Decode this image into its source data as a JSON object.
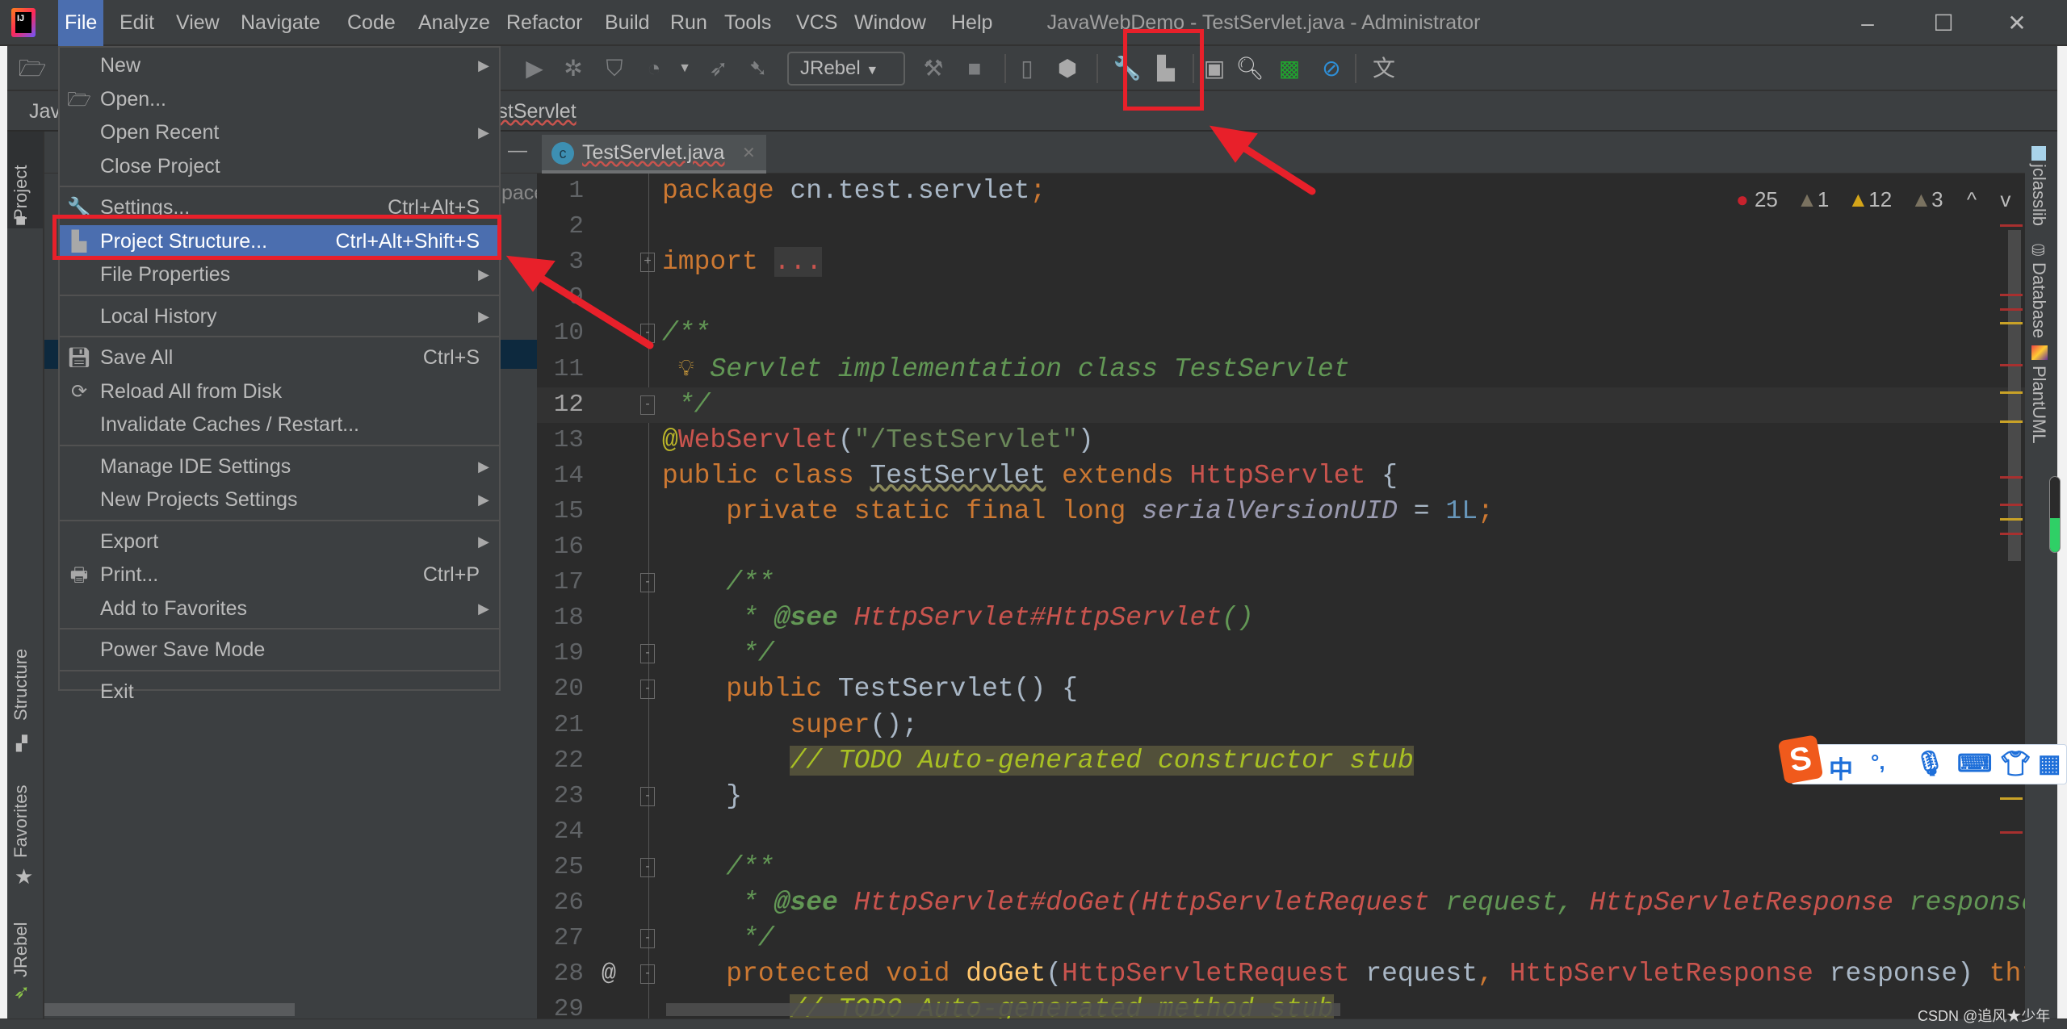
{
  "window": {
    "title": "JavaWebDemo - TestServlet.java - Administrator",
    "minimize": "–",
    "maximize": "☐",
    "close": "✕"
  },
  "menubar": [
    "File",
    "Edit",
    "View",
    "Navigate",
    "Code",
    "Analyze",
    "Refactor",
    "Build",
    "Run",
    "Tools",
    "VCS",
    "Window",
    "Help"
  ],
  "toolbar": {
    "run_config": "JRebel",
    "dropdown_arrow": "▼"
  },
  "navbar": {
    "project": "JavaWebDemo",
    "file": "TestServlet"
  },
  "project_panel": {
    "partial_text": "pace",
    "collapse": "—"
  },
  "left_tools": [
    "Project",
    "Structure",
    "Favorites",
    "JRebel"
  ],
  "right_tools": [
    "jclasslib",
    "Database",
    "PlantUML"
  ],
  "editor": {
    "tab": {
      "label": "TestServlet.java",
      "icon_letter": "c",
      "close": "✕"
    },
    "inspections": {
      "errors": "25",
      "warnings_weak": "1",
      "warnings": "12",
      "typos": "3",
      "prev": "^",
      "next": "v"
    },
    "lines": [
      {
        "n": "1",
        "t": [
          [
            "package ",
            "kw"
          ],
          [
            "cn.test.servlet",
            "tx"
          ],
          [
            ";",
            "kw"
          ]
        ]
      },
      {
        "n": "2",
        "t": []
      },
      {
        "n": "3",
        "t": [
          [
            "import ",
            "kw"
          ],
          [
            "...",
            "dots"
          ]
        ],
        "fold": "+"
      },
      {
        "n": "9",
        "t": []
      },
      {
        "n": "10",
        "t": [
          [
            "/**",
            "doc"
          ]
        ],
        "fold": "-"
      },
      {
        "n": "11",
        "t": [
          [
            " * Servlet implementation class TestServlet",
            "doc"
          ]
        ]
      },
      {
        "n": "12",
        "t": [
          [
            " */",
            "doc"
          ]
        ],
        "fold": "-",
        "current": true
      },
      {
        "n": "13",
        "t": [
          [
            "@",
            "ann"
          ],
          [
            "WebServlet",
            "err"
          ],
          [
            "(",
            "tx"
          ],
          [
            "\"/TestServlet\"",
            "str"
          ],
          [
            ")",
            "tx"
          ]
        ]
      },
      {
        "n": "14",
        "t": [
          [
            "public class ",
            "kw"
          ],
          [
            "TestServlet",
            "tx squig"
          ],
          [
            " extends ",
            "kw"
          ],
          [
            "HttpServlet",
            "err"
          ],
          [
            " {",
            "tx"
          ]
        ]
      },
      {
        "n": "15",
        "t": [
          [
            "    private static final long ",
            "kw"
          ],
          [
            "serialVersionUID",
            "fld"
          ],
          [
            " = ",
            "tx"
          ],
          [
            "1L",
            "num"
          ],
          [
            ";",
            "kw"
          ]
        ]
      },
      {
        "n": "16",
        "t": []
      },
      {
        "n": "17",
        "t": [
          [
            "    /**",
            "doc"
          ]
        ],
        "fold": "-"
      },
      {
        "n": "18",
        "t": [
          [
            "     * ",
            "doc"
          ],
          [
            "@see",
            "doct"
          ],
          [
            " HttpServlet#HttpServlet",
            "erri"
          ],
          [
            "()",
            "doc"
          ]
        ]
      },
      {
        "n": "19",
        "t": [
          [
            "     */",
            "doc"
          ]
        ],
        "fold": "-"
      },
      {
        "n": "20",
        "t": [
          [
            "    public ",
            "kw"
          ],
          [
            "TestServlet() {",
            "tx"
          ]
        ],
        "fold": "-"
      },
      {
        "n": "21",
        "t": [
          [
            "        super",
            "kw"
          ],
          [
            "();",
            "tx"
          ]
        ]
      },
      {
        "n": "22",
        "t": [
          [
            "        ",
            "tx"
          ],
          [
            "// TODO Auto-generated constructor stub",
            "todo"
          ]
        ]
      },
      {
        "n": "23",
        "t": [
          [
            "    }",
            "tx"
          ]
        ],
        "fold": "-"
      },
      {
        "n": "24",
        "t": []
      },
      {
        "n": "25",
        "t": [
          [
            "    /**",
            "doc"
          ]
        ],
        "fold": "-"
      },
      {
        "n": "26",
        "t": [
          [
            "     * ",
            "doc"
          ],
          [
            "@see",
            "doct"
          ],
          [
            " HttpServlet#doGet(HttpServletRequest",
            "erri"
          ],
          [
            " request, ",
            "doc"
          ],
          [
            "HttpServletResponse",
            "erri"
          ],
          [
            " response)",
            "doc"
          ]
        ]
      },
      {
        "n": "27",
        "t": [
          [
            "     */",
            "doc"
          ]
        ],
        "fold": "-"
      },
      {
        "n": "28",
        "t": [
          [
            "    protected void ",
            "kw"
          ],
          [
            "doGet",
            "fn"
          ],
          [
            "(",
            "tx"
          ],
          [
            "HttpServletRequest",
            "err"
          ],
          [
            " request",
            "tx"
          ],
          [
            ", ",
            "kw"
          ],
          [
            "HttpServletResponse",
            "err"
          ],
          [
            " response) ",
            "tx"
          ],
          [
            "throws ServletException, IOException {",
            "kw"
          ]
        ],
        "fold": "-",
        "gutter": "@"
      },
      {
        "n": "29",
        "t": [
          [
            "        ",
            "tx"
          ],
          [
            "// TODO Auto-generated method stub",
            "todo"
          ]
        ]
      }
    ]
  },
  "file_menu": [
    {
      "label": "New",
      "arrow": true
    },
    {
      "label": "Open...",
      "icon": "folder-open-icon"
    },
    {
      "label": "Open Recent",
      "arrow": true
    },
    {
      "label": "Close Project"
    },
    {
      "sep": true
    },
    {
      "label": "Settings...",
      "shortcut": "Ctrl+Alt+S",
      "icon": "wrench-icon"
    },
    {
      "label": "Project Structure...",
      "shortcut": "Ctrl+Alt+Shift+S",
      "icon": "project-structure-icon",
      "selected": true
    },
    {
      "label": "File Properties",
      "arrow": true
    },
    {
      "sep": true
    },
    {
      "label": "Local History",
      "arrow": true
    },
    {
      "sep": true
    },
    {
      "label": "Save All",
      "shortcut": "Ctrl+S",
      "icon": "save-icon"
    },
    {
      "label": "Reload All from Disk",
      "icon": "reload-icon"
    },
    {
      "label": "Invalidate Caches / Restart..."
    },
    {
      "sep": true
    },
    {
      "label": "Manage IDE Settings",
      "arrow": true
    },
    {
      "label": "New Projects Settings",
      "arrow": true
    },
    {
      "sep": true
    },
    {
      "label": "Export",
      "arrow": true
    },
    {
      "label": "Print...",
      "shortcut": "Ctrl+P",
      "icon": "print-icon"
    },
    {
      "label": "Add to Favorites",
      "arrow": true
    },
    {
      "sep": true
    },
    {
      "label": "Power Save Mode"
    },
    {
      "sep": true
    },
    {
      "label": "Exit"
    }
  ],
  "ime": {
    "lang": "中",
    "punct": "°,"
  },
  "watermark": "CSDN @追风★少年",
  "colors": {
    "accent": "#4b6eaf",
    "highlight": "#e8202a",
    "error": "#c9544e",
    "warning": "#d4a519"
  }
}
